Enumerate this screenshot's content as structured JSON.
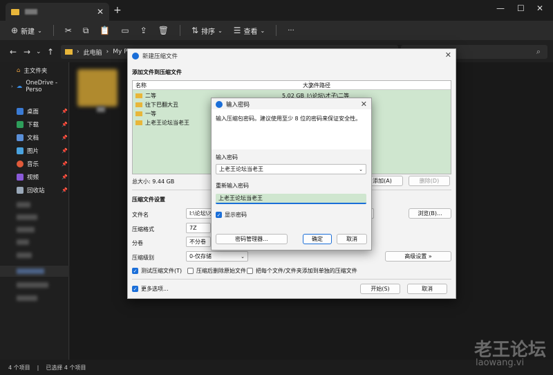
{
  "explorer": {
    "toolbar": {
      "new_label": "新建",
      "sort_label": "排序",
      "view_label": "查看",
      "more_label": "···"
    },
    "address": {
      "crumb1": "此电脑",
      "crumb2": "My Pass"
    },
    "sidebar": {
      "home": "主文件夹",
      "onedrive": "OneDrive - Perso",
      "desktop": "桌面",
      "downloads": "下载",
      "documents": "文档",
      "pictures": "图片",
      "music": "音乐",
      "videos": "视频",
      "recycle": "回收站"
    },
    "status": {
      "items": "4 个项目",
      "selected": "已选择 4 个项目"
    }
  },
  "compress_dialog": {
    "title": "新建压缩文件",
    "section_add": "添加文件到压缩文件",
    "columns": {
      "name": "名称",
      "size": "大小",
      "path": "文件路径"
    },
    "files": [
      {
        "name": "二等",
        "size": "5.02 GB",
        "path": "I:\\论坛\\才子\\二等"
      },
      {
        "name": "往下巴翻大丑",
        "size": "",
        "path": ""
      },
      {
        "name": "一等",
        "size": "",
        "path": ""
      },
      {
        "name": "上老王论坛当老王",
        "size": "",
        "path": ""
      }
    ],
    "total_size": "总大小: 9.44 GB",
    "add_button": "添加(A)",
    "delete_button": "删除(D)",
    "section_settings": "压缩文件设置",
    "filename_label": "文件名",
    "filename_value": "I:\\论坛\\才",
    "browse_button": "浏览(B)...",
    "format_label": "压缩格式",
    "format_value": "7Z",
    "split_label": "分卷",
    "split_value": "不分卷",
    "level_label": "压缩级别",
    "level_value": "0-仅存储",
    "advanced_button": "高级设置 »",
    "test_label": "测试压缩文件(T)",
    "delete_src_label": "压缩后删除原始文件",
    "each_label": "把每个文件/文件夹添加到单独的压缩文件",
    "more_options": "更多选项...",
    "start_button": "开始(S)",
    "cancel_button": "取消"
  },
  "password_dialog": {
    "title": "输入密码",
    "hint": "输入压缩包密码。建议使用至少 8 位的密码来保证安全性。",
    "enter_label": "输入密码",
    "enter_value": "上老王论坛当老王",
    "reenter_label": "重新输入密码",
    "reenter_value": "上老王论坛当老王",
    "show_label": "显示密码",
    "manager_button": "密码管理器...",
    "ok_button": "确定",
    "cancel_button": "取消"
  },
  "watermark": {
    "text": "老王论坛",
    "url": "laowang.vi"
  }
}
